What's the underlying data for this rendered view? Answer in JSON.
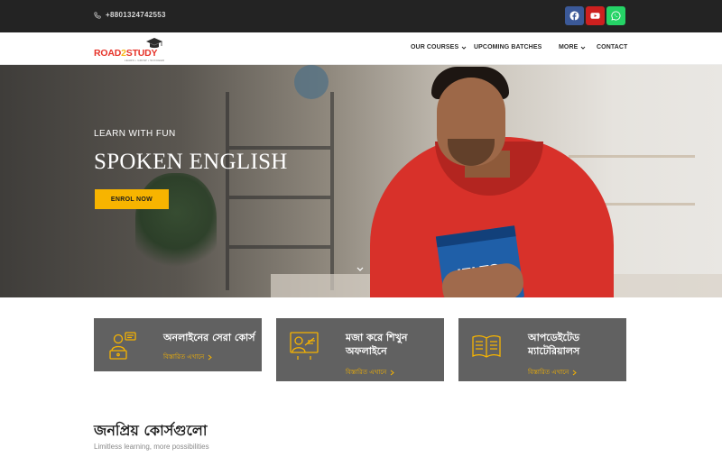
{
  "topbar": {
    "phone": "+8801324742553",
    "social": [
      "facebook-icon",
      "youtube-icon",
      "whatsapp-icon"
    ],
    "colors": {
      "background": "#232323",
      "facebook": "#3b5998",
      "youtube": "#cd201f",
      "whatsapp": "#25d366"
    }
  },
  "header": {
    "logo": {
      "prefix": "ROAD",
      "number": "2",
      "suffix": "STUDY",
      "tagline": "LEARN • GROW • SUCCEED"
    },
    "nav": [
      {
        "label": "OUR COURSES",
        "has_dropdown": true
      },
      {
        "label": "UPCOMING BATCHES",
        "has_dropdown": false
      },
      {
        "label": "MORE",
        "has_dropdown": true
      },
      {
        "label": "CONTACT",
        "has_dropdown": false
      }
    ]
  },
  "hero": {
    "kicker": "LEARN WITH FUN",
    "title": "SPOKEN ENGLISH",
    "cta": "ENROL NOW",
    "book_label": "IELTS",
    "accent": "#f7b400"
  },
  "features": [
    {
      "title": "অনলাইনের সেরা কোর্স",
      "link": "বিস্তারিত এখানে",
      "icon": "online-learning-icon"
    },
    {
      "title_line1": "মজা করে শিখুন",
      "title_line2": "অফলাইনে",
      "link": "বিস্তারিত এখানে",
      "icon": "classroom-teacher-icon"
    },
    {
      "title_line1": "আপডেইটেড",
      "title_line2": "ম্যাটেরিয়ালস",
      "link": "বিস্তারিত এখানে",
      "icon": "open-book-icon"
    }
  ],
  "section": {
    "title": "জনপ্রিয় কোর্সগুলো",
    "subtitle": "Limitless learning, more possibilities"
  }
}
